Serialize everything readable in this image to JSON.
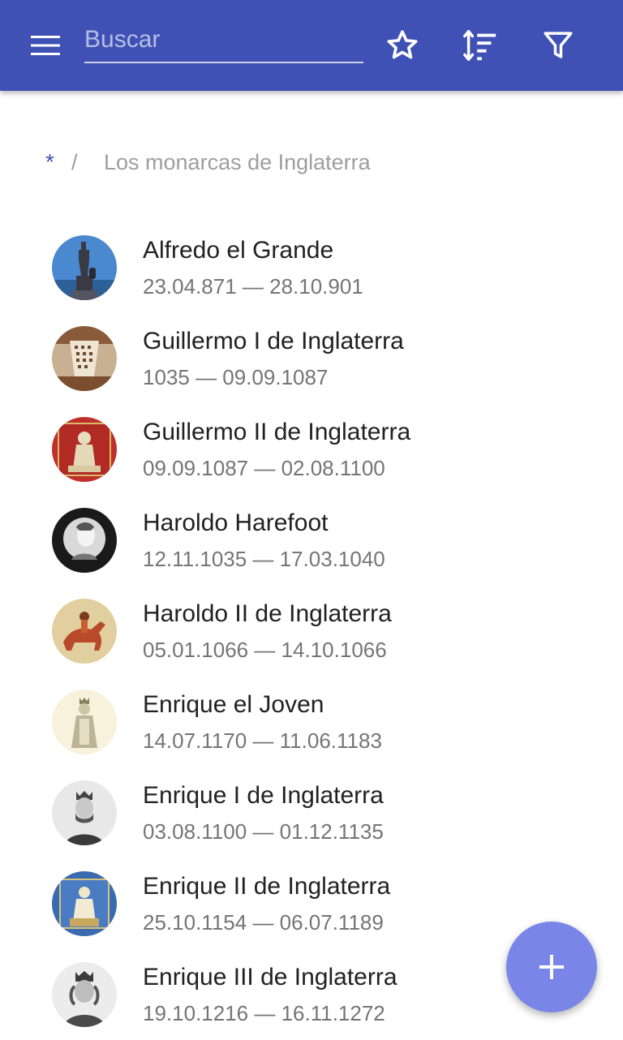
{
  "toolbar": {
    "search_placeholder": "Buscar",
    "menu_icon": "menu-icon",
    "favorite_icon": "star-outline-icon",
    "sort_icon": "sort-icon",
    "filter_icon": "filter-icon",
    "background_color": "#3f51b5"
  },
  "breadcrumb": {
    "root": "*",
    "separator": "/",
    "current": "Los monarcas de Inglaterra"
  },
  "monarchs": [
    {
      "name": "Alfredo el Grande",
      "dates": "23.04.871 — 28.10.901"
    },
    {
      "name": "Guillermo I de Inglaterra",
      "dates": "1035 — 09.09.1087"
    },
    {
      "name": "Guillermo II de Inglaterra",
      "dates": "09.09.1087 — 02.08.1100"
    },
    {
      "name": "Haroldo Harefoot",
      "dates": "12.11.1035 — 17.03.1040"
    },
    {
      "name": "Haroldo II de Inglaterra",
      "dates": "05.01.1066 — 14.10.1066"
    },
    {
      "name": "Enrique el Joven",
      "dates": "14.07.1170 — 11.06.1183"
    },
    {
      "name": "Enrique I de Inglaterra",
      "dates": "03.08.1100 — 01.12.1135"
    },
    {
      "name": "Enrique II de Inglaterra",
      "dates": "25.10.1154 — 06.07.1189"
    },
    {
      "name": "Enrique III de Inglaterra",
      "dates": "19.10.1216 — 16.11.1272"
    }
  ],
  "fab": {
    "icon": "plus-icon",
    "color": "#7986e8"
  }
}
